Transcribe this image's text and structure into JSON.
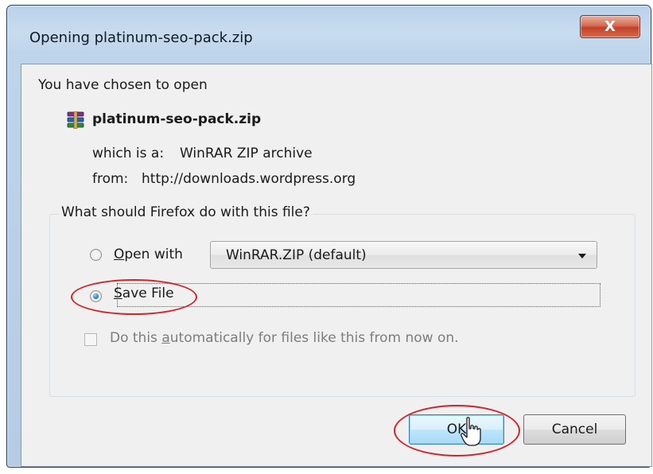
{
  "window": {
    "title": "Opening platinum-seo-pack.zip",
    "close_glyph": "X"
  },
  "intro": "You have chosen to open",
  "file": {
    "name": "platinum-seo-pack.zip",
    "icon": "winrar-archive-icon",
    "type_label": "which is a:",
    "type_value": "WinRAR ZIP archive",
    "from_label": "from:",
    "from_value": "http://downloads.wordpress.org"
  },
  "group": {
    "legend": "What should Firefox do with this file?",
    "open_with": {
      "label_mnemonic": "O",
      "label_rest": "pen with",
      "checked": false
    },
    "app_select": {
      "selected": "WinRAR.ZIP (default)"
    },
    "save_file": {
      "label_mnemonic": "S",
      "label_rest": "ave File",
      "checked": true
    },
    "auto": {
      "label_before": "Do this ",
      "label_mnemonic": "a",
      "label_after": "utomatically for files like this from now on.",
      "checked": false,
      "enabled": false
    }
  },
  "buttons": {
    "ok": "OK",
    "cancel": "Cancel"
  },
  "colors": {
    "highlight": "#d4242b",
    "title_bar": "#c9dcef",
    "close_button": "#c2412a",
    "default_button": "#bee6fd"
  }
}
